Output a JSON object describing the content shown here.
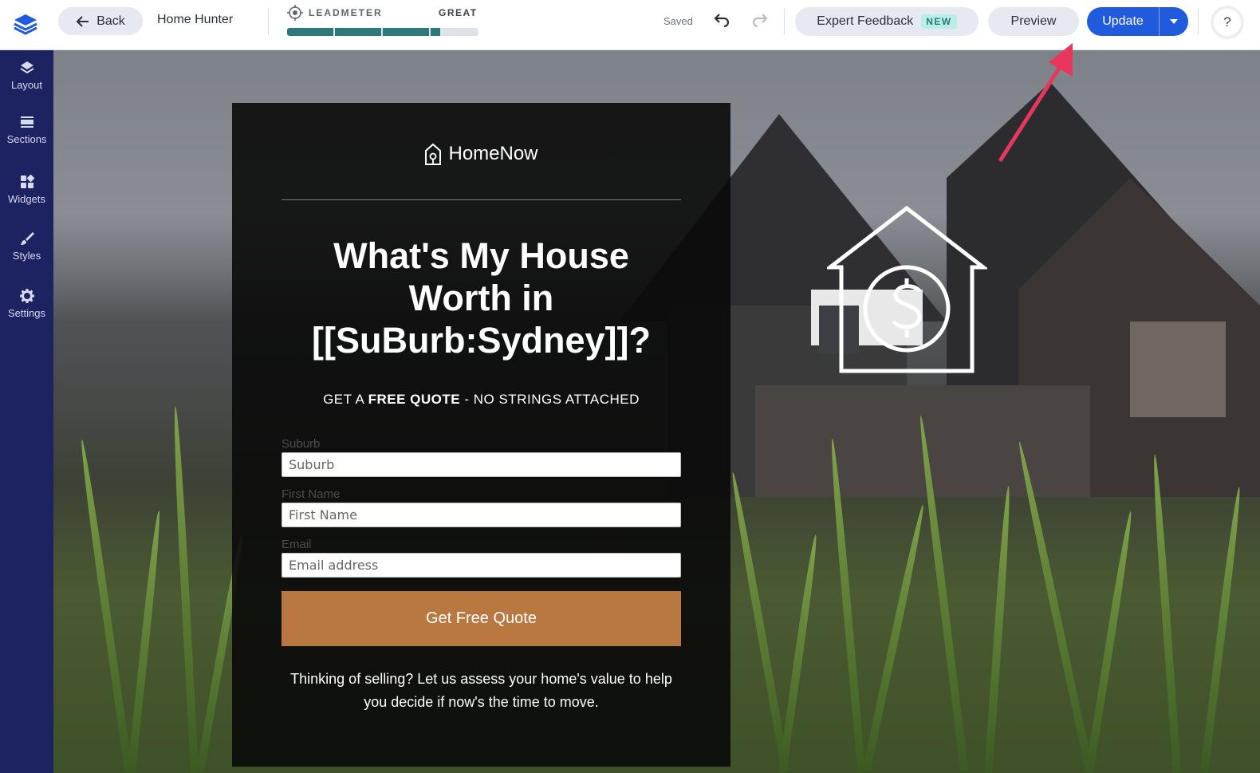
{
  "header": {
    "back_label": "Back",
    "page_name": "Home Hunter",
    "leadmeter": {
      "label": "LEADMETER",
      "score": "GREAT",
      "progress": 0.81
    },
    "saved_label": "Saved",
    "expert_feedback_label": "Expert Feedback",
    "new_badge": "NEW",
    "preview_label": "Preview",
    "update_label": "Update",
    "help_label": "?"
  },
  "sidebar": {
    "items": [
      {
        "label": "Layout",
        "icon": "layers-icon"
      },
      {
        "label": "Sections",
        "icon": "sections-icon"
      },
      {
        "label": "Widgets",
        "icon": "widgets-icon"
      },
      {
        "label": "Styles",
        "icon": "brush-icon"
      },
      {
        "label": "Settings",
        "icon": "gear-icon"
      }
    ]
  },
  "form": {
    "brand_name": "HomeNow",
    "headline": "What's My House Worth in [[SuBurb:Sydney]]?",
    "tagline_prefix": "GET A ",
    "tagline_bold": "FREE QUOTE",
    "tagline_suffix": " - NO STRINGS ATTACHED",
    "fields": [
      {
        "label": "Suburb",
        "placeholder": "Suburb"
      },
      {
        "label": "First Name",
        "placeholder": "First Name"
      },
      {
        "label": "Email",
        "placeholder": "Email address"
      }
    ],
    "cta_label": "Get Free Quote",
    "blurb": "Thinking of selling? Let us assess your home's value to help you decide if now's the time to move."
  },
  "colors": {
    "sidebar_bg": "#1d2260",
    "update_button": "#1f5bdc",
    "cta_button": "#b87840",
    "leadmeter_fill": "#2e7a7a",
    "annotation_arrow": "#e8365d"
  }
}
